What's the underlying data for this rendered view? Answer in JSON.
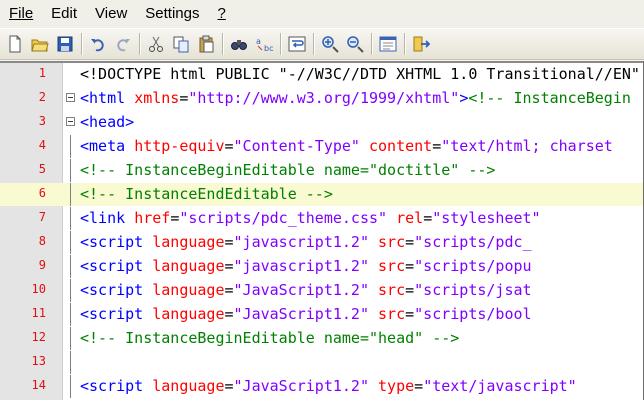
{
  "menu": [
    {
      "label": "File"
    },
    {
      "label": "Edit"
    },
    {
      "label": "View"
    },
    {
      "label": "Settings"
    },
    {
      "label": "?"
    }
  ],
  "toolbar": [
    {
      "name": "new-file-icon"
    },
    {
      "name": "open-folder-icon"
    },
    {
      "name": "save-icon"
    },
    {
      "sep": true
    },
    {
      "name": "undo-icon"
    },
    {
      "name": "redo-icon"
    },
    {
      "sep": true
    },
    {
      "name": "cut-icon"
    },
    {
      "name": "copy-icon"
    },
    {
      "name": "paste-icon"
    },
    {
      "sep": true
    },
    {
      "name": "find-icon"
    },
    {
      "name": "replace-icon"
    },
    {
      "sep": true
    },
    {
      "name": "word-wrap-icon"
    },
    {
      "sep": true
    },
    {
      "name": "zoom-in-icon"
    },
    {
      "name": "zoom-out-icon"
    },
    {
      "sep": true
    },
    {
      "name": "settings-window-icon"
    },
    {
      "sep": true
    },
    {
      "name": "exit-icon"
    }
  ],
  "editor": {
    "colors": {
      "tag": "#0000ff",
      "attr": "#ff0000",
      "value": "#8000ff",
      "comment": "#008000",
      "line_number": "#e01010",
      "current_line": "#fafad2"
    },
    "lines": [
      {
        "num": "1",
        "tokens": [
          {
            "t": "doc",
            "v": "<!DOCTYPE html PUBLIC \"-//W3C//DTD XHTML 1.0 Transitional//EN\""
          }
        ]
      },
      {
        "num": "2",
        "fold": true,
        "tokens": [
          {
            "t": "tag",
            "v": "<html"
          },
          {
            "t": "plain",
            "v": " "
          },
          {
            "t": "attr",
            "v": "xmlns"
          },
          {
            "t": "plain",
            "v": "="
          },
          {
            "t": "val",
            "v": "\"http://www.w3.org/1999/xhtml\""
          },
          {
            "t": "tag",
            "v": ">"
          },
          {
            "t": "cm",
            "v": "<!-- InstanceBegin"
          }
        ]
      },
      {
        "num": "3",
        "fold": true,
        "tokens": [
          {
            "t": "tag",
            "v": "<head>"
          }
        ]
      },
      {
        "num": "4",
        "tokens": [
          {
            "t": "tag",
            "v": "<meta"
          },
          {
            "t": "plain",
            "v": " "
          },
          {
            "t": "attr",
            "v": "http-equiv"
          },
          {
            "t": "plain",
            "v": "="
          },
          {
            "t": "val",
            "v": "\"Content-Type\""
          },
          {
            "t": "plain",
            "v": " "
          },
          {
            "t": "attr",
            "v": "content"
          },
          {
            "t": "plain",
            "v": "="
          },
          {
            "t": "val",
            "v": "\"text/html; charset"
          }
        ]
      },
      {
        "num": "5",
        "tokens": [
          {
            "t": "cm",
            "v": "<!-- InstanceBeginEditable name=\"doctitle\" -->"
          }
        ]
      },
      {
        "num": "6",
        "hl": true,
        "tokens": [
          {
            "t": "cm",
            "v": "<!-- InstanceEndEditable -->"
          }
        ]
      },
      {
        "num": "7",
        "tokens": [
          {
            "t": "tag",
            "v": "<link"
          },
          {
            "t": "plain",
            "v": " "
          },
          {
            "t": "attr",
            "v": "href"
          },
          {
            "t": "plain",
            "v": "="
          },
          {
            "t": "val",
            "v": "\"scripts/pdc_theme.css\""
          },
          {
            "t": "plain",
            "v": " "
          },
          {
            "t": "attr",
            "v": "rel"
          },
          {
            "t": "plain",
            "v": "="
          },
          {
            "t": "val",
            "v": "\"stylesheet\""
          }
        ]
      },
      {
        "num": "8",
        "tokens": [
          {
            "t": "tag",
            "v": "<script"
          },
          {
            "t": "plain",
            "v": " "
          },
          {
            "t": "attr",
            "v": "language"
          },
          {
            "t": "plain",
            "v": "="
          },
          {
            "t": "val",
            "v": "\"javascript1.2\""
          },
          {
            "t": "plain",
            "v": " "
          },
          {
            "t": "attr",
            "v": "src"
          },
          {
            "t": "plain",
            "v": "="
          },
          {
            "t": "val",
            "v": "\"scripts/pdc_"
          }
        ]
      },
      {
        "num": "9",
        "tokens": [
          {
            "t": "tag",
            "v": "<script"
          },
          {
            "t": "plain",
            "v": " "
          },
          {
            "t": "attr",
            "v": "language"
          },
          {
            "t": "plain",
            "v": "="
          },
          {
            "t": "val",
            "v": "\"javascript1.2\""
          },
          {
            "t": "plain",
            "v": " "
          },
          {
            "t": "attr",
            "v": "src"
          },
          {
            "t": "plain",
            "v": "="
          },
          {
            "t": "val",
            "v": "\"scripts/popu"
          }
        ]
      },
      {
        "num": "10",
        "tokens": [
          {
            "t": "tag",
            "v": "<script"
          },
          {
            "t": "plain",
            "v": " "
          },
          {
            "t": "attr",
            "v": "language"
          },
          {
            "t": "plain",
            "v": "="
          },
          {
            "t": "val",
            "v": "\"JavaScript1.2\""
          },
          {
            "t": "plain",
            "v": " "
          },
          {
            "t": "attr",
            "v": "src"
          },
          {
            "t": "plain",
            "v": "="
          },
          {
            "t": "val",
            "v": "\"scripts/jsat"
          }
        ]
      },
      {
        "num": "11",
        "tokens": [
          {
            "t": "tag",
            "v": "<script"
          },
          {
            "t": "plain",
            "v": " "
          },
          {
            "t": "attr",
            "v": "language"
          },
          {
            "t": "plain",
            "v": "="
          },
          {
            "t": "val",
            "v": "\"JavaScript1.2\""
          },
          {
            "t": "plain",
            "v": " "
          },
          {
            "t": "attr",
            "v": "src"
          },
          {
            "t": "plain",
            "v": "="
          },
          {
            "t": "val",
            "v": "\"scripts/bool"
          }
        ]
      },
      {
        "num": "12",
        "tokens": [
          {
            "t": "cm",
            "v": "<!-- InstanceBeginEditable name=\"head\" -->"
          }
        ]
      },
      {
        "num": "13",
        "tokens": []
      },
      {
        "num": "14",
        "tokens": [
          {
            "t": "tag",
            "v": "<script"
          },
          {
            "t": "plain",
            "v": " "
          },
          {
            "t": "attr",
            "v": "language"
          },
          {
            "t": "plain",
            "v": "="
          },
          {
            "t": "val",
            "v": "\"JavaScript1.2\""
          },
          {
            "t": "plain",
            "v": " "
          },
          {
            "t": "attr",
            "v": "type"
          },
          {
            "t": "plain",
            "v": "="
          },
          {
            "t": "val",
            "v": "\"text/javascript\""
          }
        ]
      }
    ]
  }
}
